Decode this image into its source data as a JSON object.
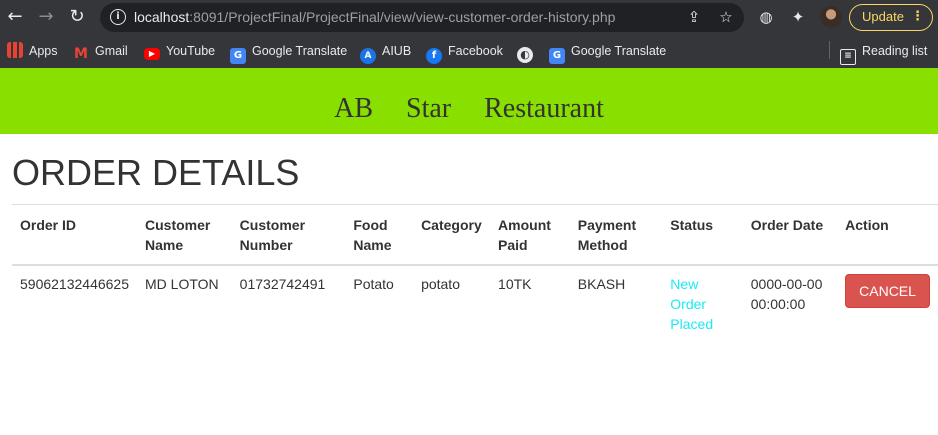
{
  "browser": {
    "url_host": "localhost",
    "url_rest": ":8091/ProjectFinal/ProjectFinal/view/view-customer-order-history.php",
    "update_label": "Update",
    "bookmarks": [
      {
        "label": "Apps",
        "icon": "apps-grid-icon"
      },
      {
        "label": "Gmail",
        "icon": "gmail-icon"
      },
      {
        "label": "YouTube",
        "icon": "youtube-icon"
      },
      {
        "label": "Google Translate",
        "icon": "google-translate-icon"
      },
      {
        "label": "AIUB",
        "icon": "aiub-icon"
      },
      {
        "label": "Facebook",
        "icon": "facebook-icon"
      },
      {
        "label": "",
        "icon": "globe-icon"
      },
      {
        "label": "Google Translate",
        "icon": "google-translate-icon"
      }
    ],
    "reading_list_label": "Reading list"
  },
  "header": {
    "title": "AB Star Restaurant",
    "background": "#89e000"
  },
  "page": {
    "heading": "ORDER DETAILS"
  },
  "table": {
    "columns": {
      "order_id": "Order ID",
      "customer_name": "Customer Name",
      "customer_number": "Customer Number",
      "food_name": "Food Name",
      "category": "Category",
      "amount_paid": "Amount Paid",
      "payment_method": "Payment Method",
      "status": "Status",
      "order_date": "Order Date",
      "action": "Action"
    },
    "rows": [
      {
        "order_id": "59062132446625",
        "customer_name": "MD LOTON",
        "customer_number": "01732742491",
        "food_name": "Potato",
        "category": "potato",
        "amount_paid": "10TK",
        "payment_method": "BKASH",
        "status": "New Order Placed",
        "order_date": "0000-00-00 00:00:00",
        "action_label": "CANCEL"
      }
    ]
  },
  "colors": {
    "status": "#1de9f4",
    "cancel_button": "#d9534f"
  }
}
